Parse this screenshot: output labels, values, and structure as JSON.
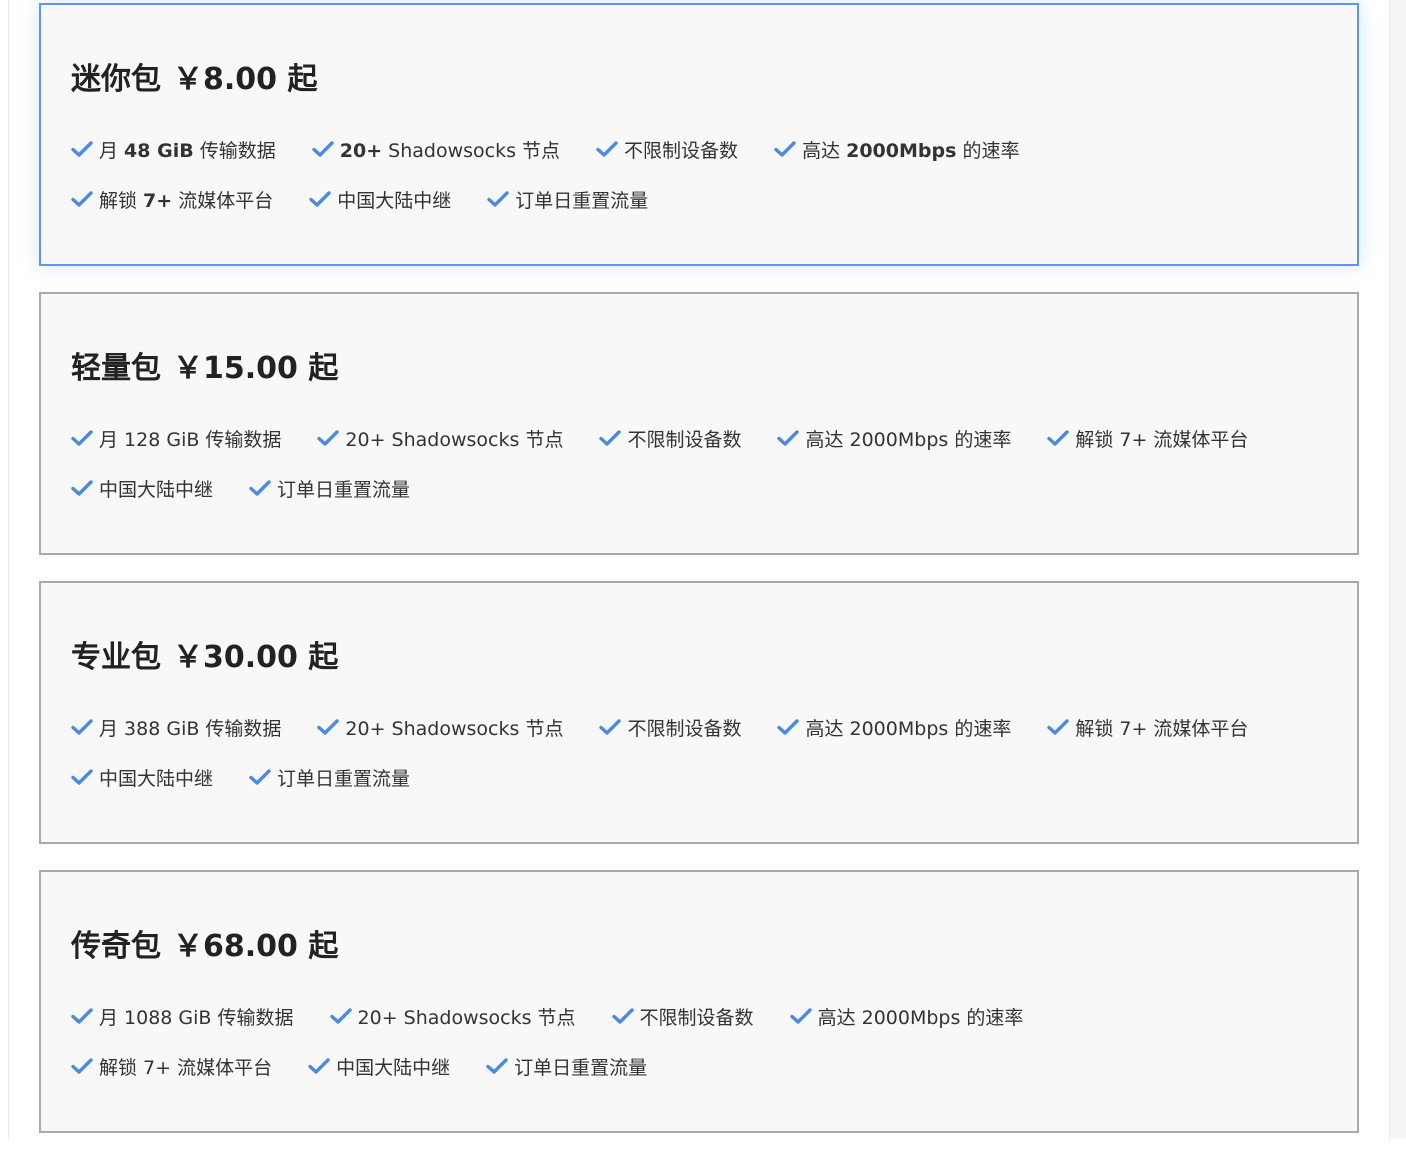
{
  "accent_color": "#4a8ae6",
  "plans": [
    {
      "name": "迷你包",
      "price": "￥8.00 起",
      "highlighted": true,
      "features": [
        {
          "label": "月 48 GiB 传输数据",
          "pre": "月 ",
          "strong": "48 GiB",
          "post": " 传输数据"
        },
        {
          "label": "20+ Shadowsocks 节点",
          "pre": "",
          "strong": "20+",
          "post": " Shadowsocks 节点"
        },
        {
          "label": "不限制设备数",
          "pre": "不限制设备数",
          "strong": "",
          "post": ""
        },
        {
          "label": "高达 2000Mbps 的速率",
          "pre": "高达 ",
          "strong": "2000Mbps",
          "post": " 的速率"
        },
        {
          "label": "解锁 7+ 流媒体平台",
          "pre": "解锁 ",
          "strong": "7+",
          "post": " 流媒体平台"
        },
        {
          "label": "中国大陆中继",
          "pre": "中国大陆中继",
          "strong": "",
          "post": ""
        },
        {
          "label": "订单日重置流量",
          "pre": "订单日重置流量",
          "strong": "",
          "post": ""
        }
      ]
    },
    {
      "name": "轻量包",
      "price": "￥15.00 起",
      "highlighted": false,
      "features": [
        {
          "label": "月 128 GiB 传输数据",
          "pre": "月 128 GiB 传输数据",
          "strong": "",
          "post": ""
        },
        {
          "label": "20+ Shadowsocks 节点",
          "pre": "20+ Shadowsocks 节点",
          "strong": "",
          "post": ""
        },
        {
          "label": "不限制设备数",
          "pre": "不限制设备数",
          "strong": "",
          "post": ""
        },
        {
          "label": "高达 2000Mbps 的速率",
          "pre": "高达 2000Mbps 的速率",
          "strong": "",
          "post": ""
        },
        {
          "label": "解锁 7+ 流媒体平台",
          "pre": "解锁 7+ 流媒体平台",
          "strong": "",
          "post": ""
        },
        {
          "label": "中国大陆中继",
          "pre": "中国大陆中继",
          "strong": "",
          "post": ""
        },
        {
          "label": "订单日重置流量",
          "pre": "订单日重置流量",
          "strong": "",
          "post": ""
        }
      ]
    },
    {
      "name": "专业包",
      "price": "￥30.00 起",
      "highlighted": false,
      "features": [
        {
          "label": "月 388 GiB 传输数据",
          "pre": "月 388 GiB 传输数据",
          "strong": "",
          "post": ""
        },
        {
          "label": "20+ Shadowsocks 节点",
          "pre": "20+ Shadowsocks 节点",
          "strong": "",
          "post": ""
        },
        {
          "label": "不限制设备数",
          "pre": "不限制设备数",
          "strong": "",
          "post": ""
        },
        {
          "label": "高达 2000Mbps 的速率",
          "pre": "高达 2000Mbps 的速率",
          "strong": "",
          "post": ""
        },
        {
          "label": "解锁 7+ 流媒体平台",
          "pre": "解锁 7+ 流媒体平台",
          "strong": "",
          "post": ""
        },
        {
          "label": "中国大陆中继",
          "pre": "中国大陆中继",
          "strong": "",
          "post": ""
        },
        {
          "label": "订单日重置流量",
          "pre": "订单日重置流量",
          "strong": "",
          "post": ""
        }
      ]
    },
    {
      "name": "传奇包",
      "price": "￥68.00 起",
      "highlighted": false,
      "features": [
        {
          "label": "月 1088 GiB 传输数据",
          "pre": "月 1088 GiB 传输数据",
          "strong": "",
          "post": ""
        },
        {
          "label": "20+ Shadowsocks 节点",
          "pre": "20+ Shadowsocks 节点",
          "strong": "",
          "post": ""
        },
        {
          "label": "不限制设备数",
          "pre": "不限制设备数",
          "strong": "",
          "post": ""
        },
        {
          "label": "高达 2000Mbps 的速率",
          "pre": "高达 2000Mbps 的速率",
          "strong": "",
          "post": ""
        },
        {
          "label": "解锁 7+ 流媒体平台",
          "pre": "解锁 7+ 流媒体平台",
          "strong": "",
          "post": ""
        },
        {
          "label": "中国大陆中继",
          "pre": "中国大陆中继",
          "strong": "",
          "post": ""
        },
        {
          "label": "订单日重置流量",
          "pre": "订单日重置流量",
          "strong": "",
          "post": ""
        }
      ]
    }
  ]
}
